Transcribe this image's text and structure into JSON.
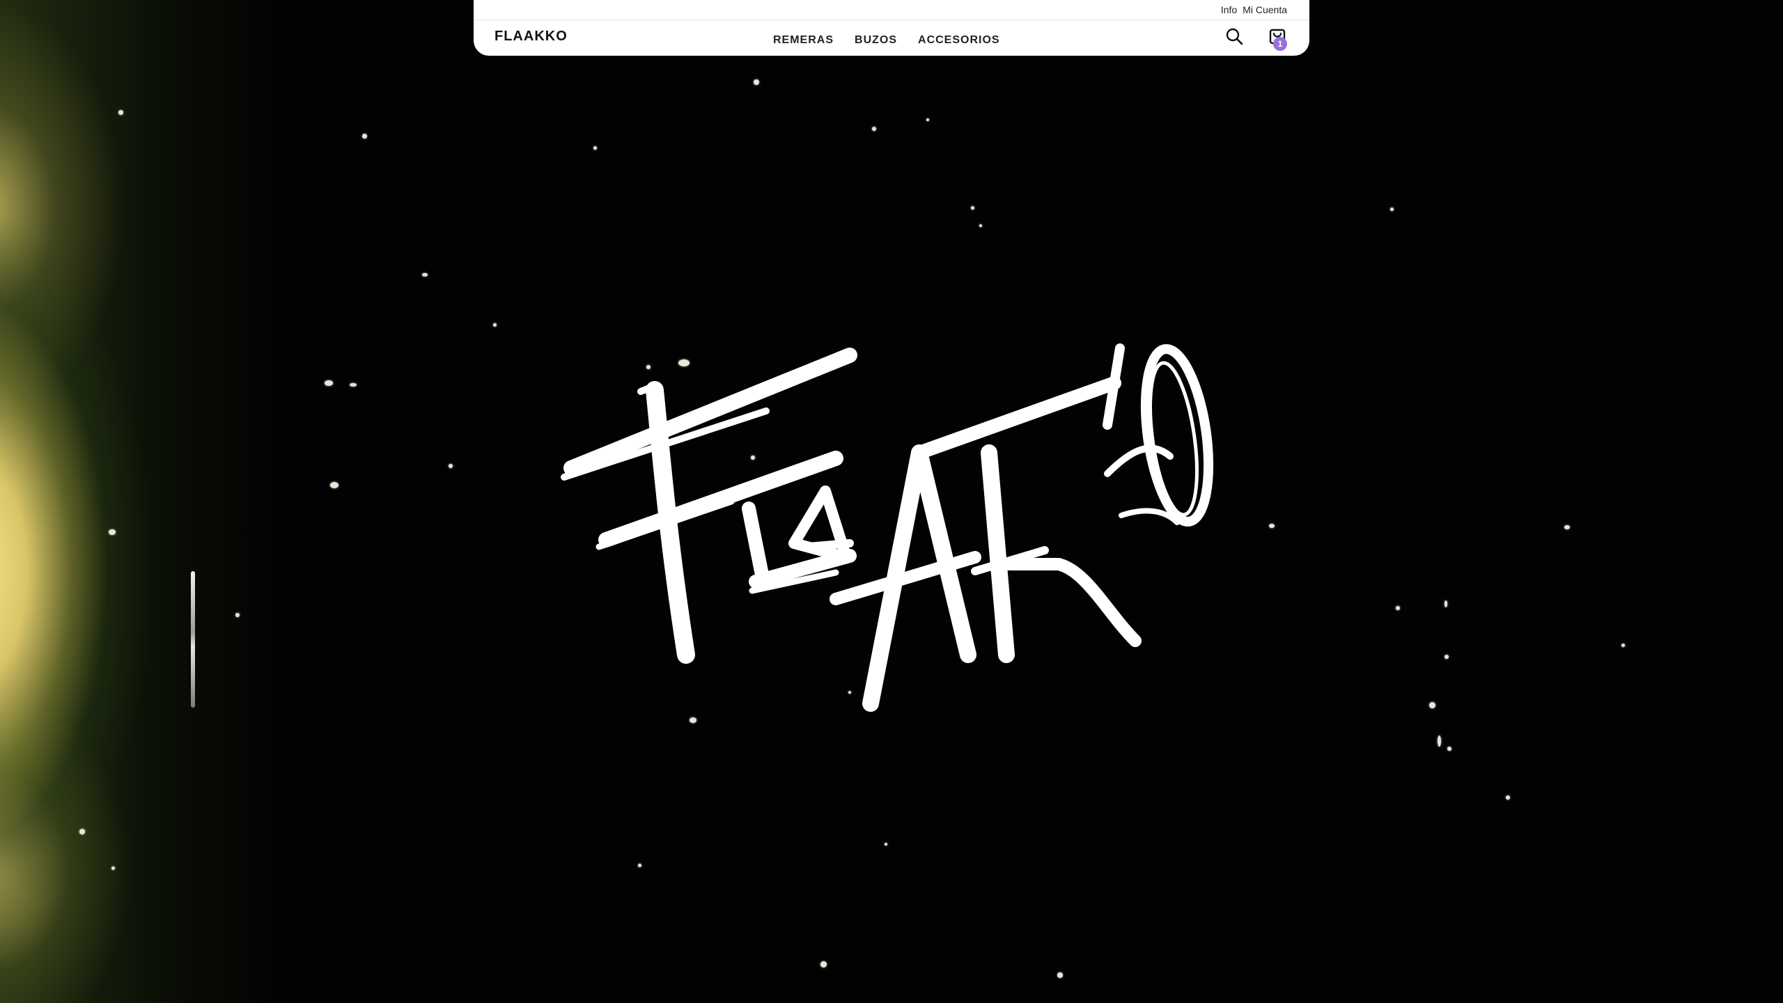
{
  "topbar": {
    "info": "Info",
    "account": "Mi Cuenta"
  },
  "header": {
    "brand": "FLAAKKO",
    "nav": [
      {
        "label": "REMERAS"
      },
      {
        "label": "BUZOS"
      },
      {
        "label": "ACCESORIOS"
      }
    ],
    "search_icon": "search-icon",
    "cart_icon": "shopping-bag-icon",
    "cart_count": "1"
  },
  "hero": {
    "logo_text": "FLAAKKO",
    "logo_style": "hand-drawn white brush lettering",
    "background": "black film with light leak and dust specks"
  },
  "colors": {
    "header_bg": "#ffffff",
    "text": "#222222",
    "badge": "#9b6ee0",
    "hero_bg": "#020202",
    "logo": "#ffffff"
  }
}
